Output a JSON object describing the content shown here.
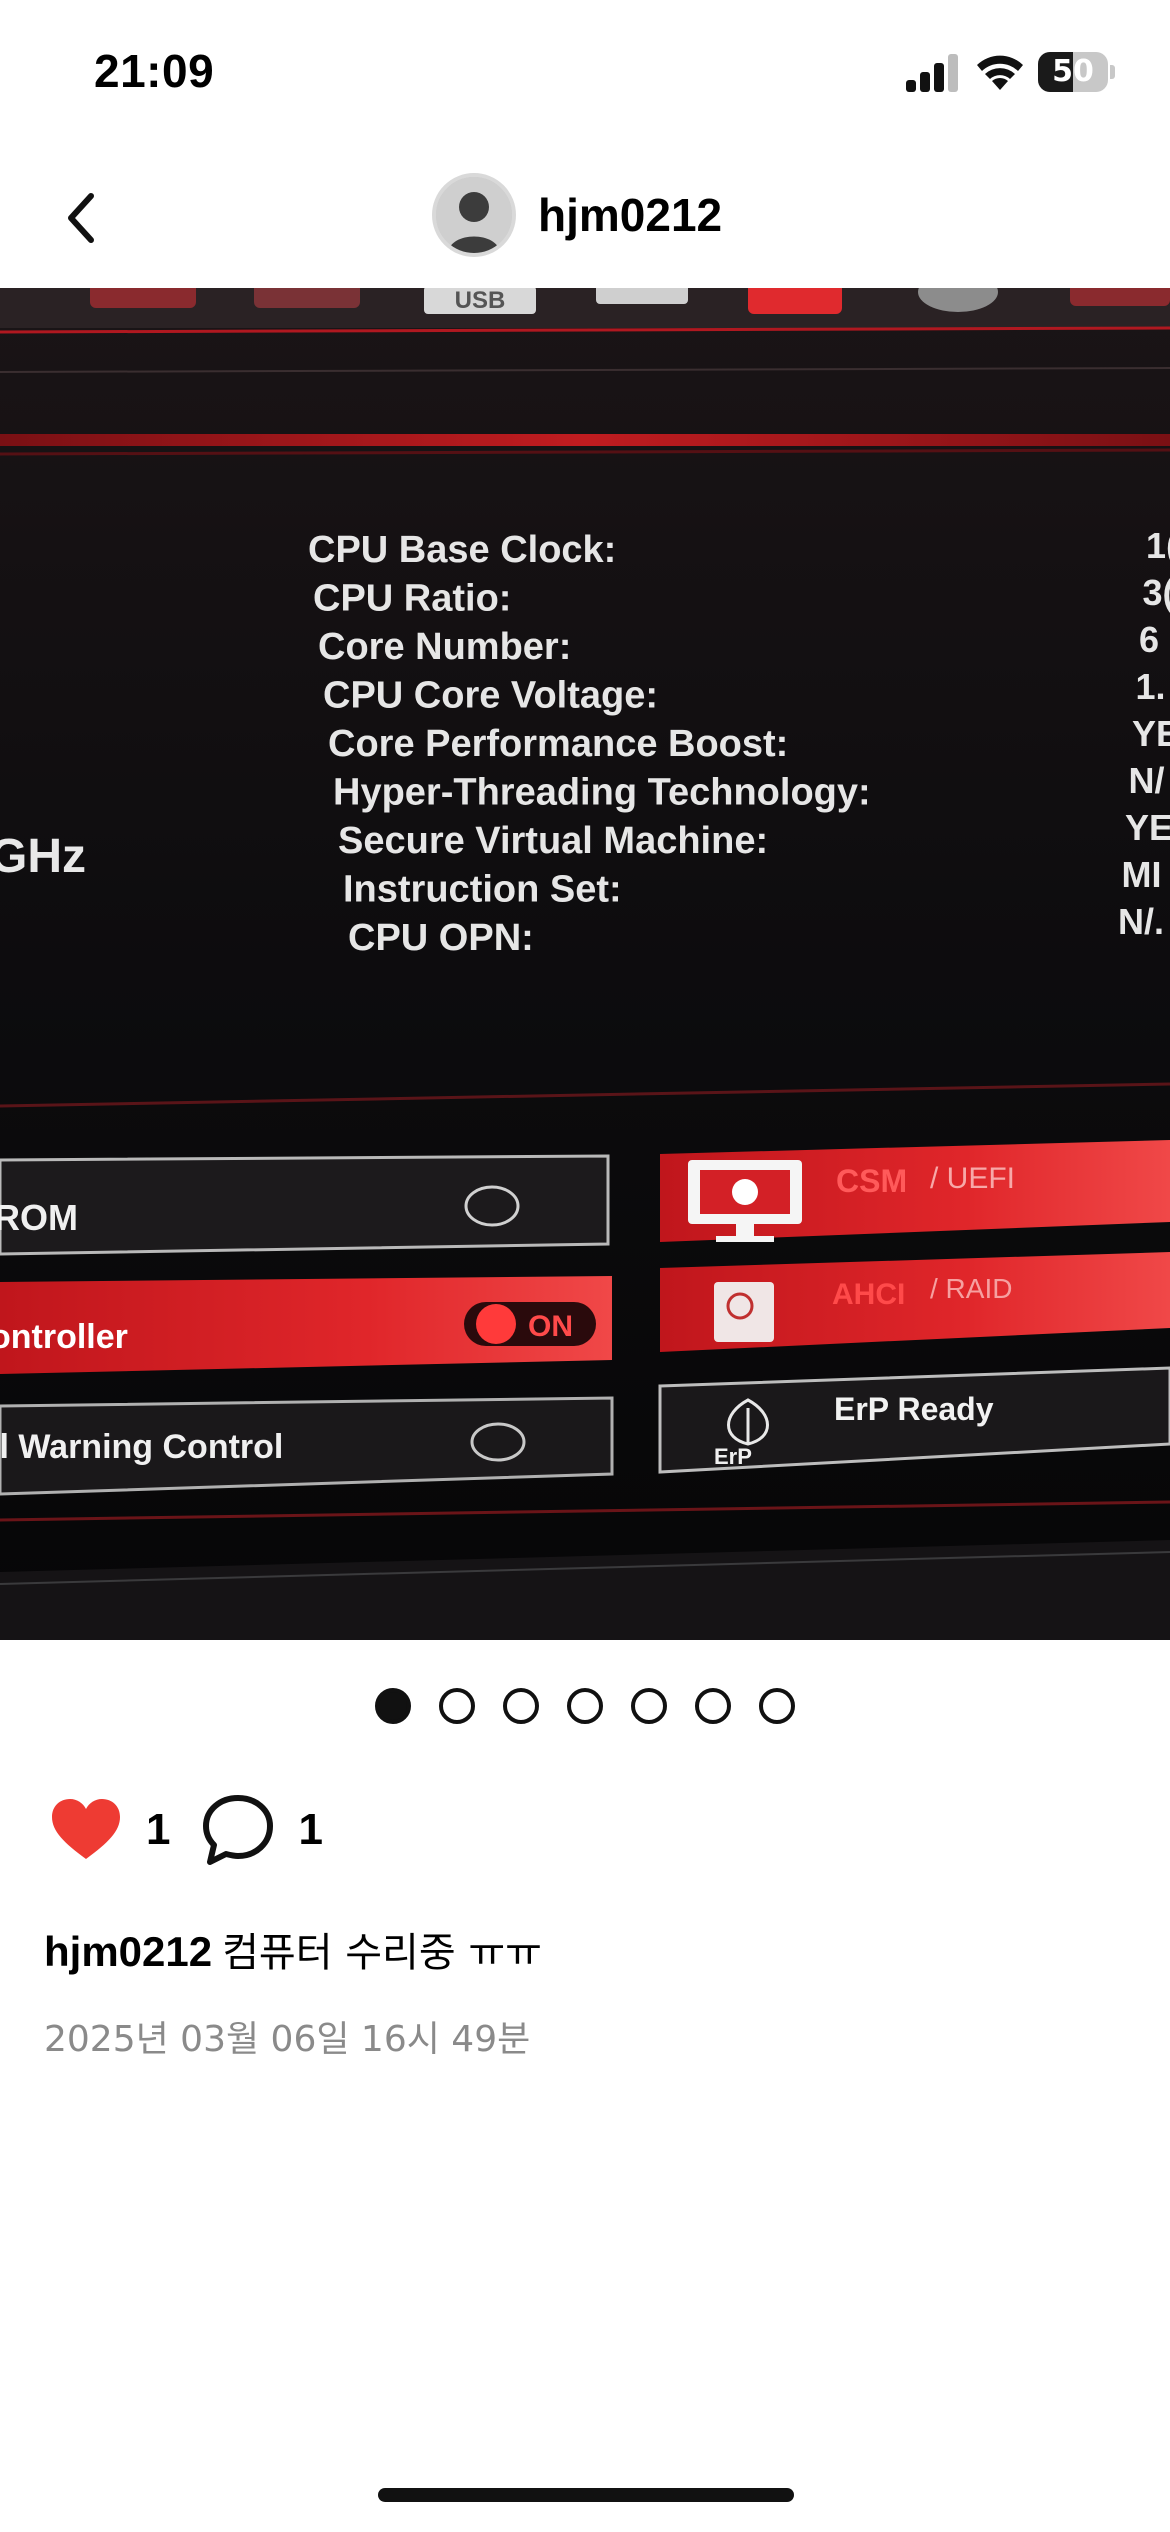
{
  "status_bar": {
    "time": "21:09",
    "battery_percent": 50,
    "battery_label": "50",
    "icons": [
      "cellular-signal-icon",
      "wifi-icon",
      "battery-icon"
    ]
  },
  "header": {
    "back_icon": "chevron-left-icon",
    "username": "hjm0212",
    "avatar_icon": "default-avatar-icon"
  },
  "photo": {
    "top_icon_text": "USB",
    "ghz_text": "GHz",
    "cpu_info": [
      {
        "label": "CPU Base Clock:",
        "value": "1("
      },
      {
        "label": "CPU Ratio:",
        "value": "3("
      },
      {
        "label": "Core Number:",
        "value": "6"
      },
      {
        "label": "CPU Core Voltage:",
        "value": "1."
      },
      {
        "label": "Core Performance Boost:",
        "value": "YE"
      },
      {
        "label": "Hyper-Threading Technology:",
        "value": "N/"
      },
      {
        "label": "Secure Virtual Machine:",
        "value": "YE"
      },
      {
        "label": "Instruction Set:",
        "value": "MI"
      },
      {
        "label": "CPU OPN:",
        "value": "N/."
      }
    ],
    "tiles": {
      "rom": "ROM",
      "controller": "ontroller",
      "on_label": "ON",
      "warning": "il Warning Control",
      "csm": "CSM",
      "uefi": "/ UEFI",
      "ahci": "AHCI",
      "raid": "/ RAID",
      "erp": "ErP Ready",
      "erp_icon_text": "ErP"
    }
  },
  "carousel": {
    "total": 7,
    "active_index": 0
  },
  "actions": {
    "like_icon": "heart-icon",
    "like_count": "1",
    "comment_icon": "comment-bubble-icon",
    "comment_count": "1",
    "like_color": "#ee3b33"
  },
  "post": {
    "caption_user": "hjm0212",
    "caption_text": "컴퓨터 수리중 ㅠㅠ",
    "timestamp": "2025년 03월 06일 16시 49분"
  }
}
